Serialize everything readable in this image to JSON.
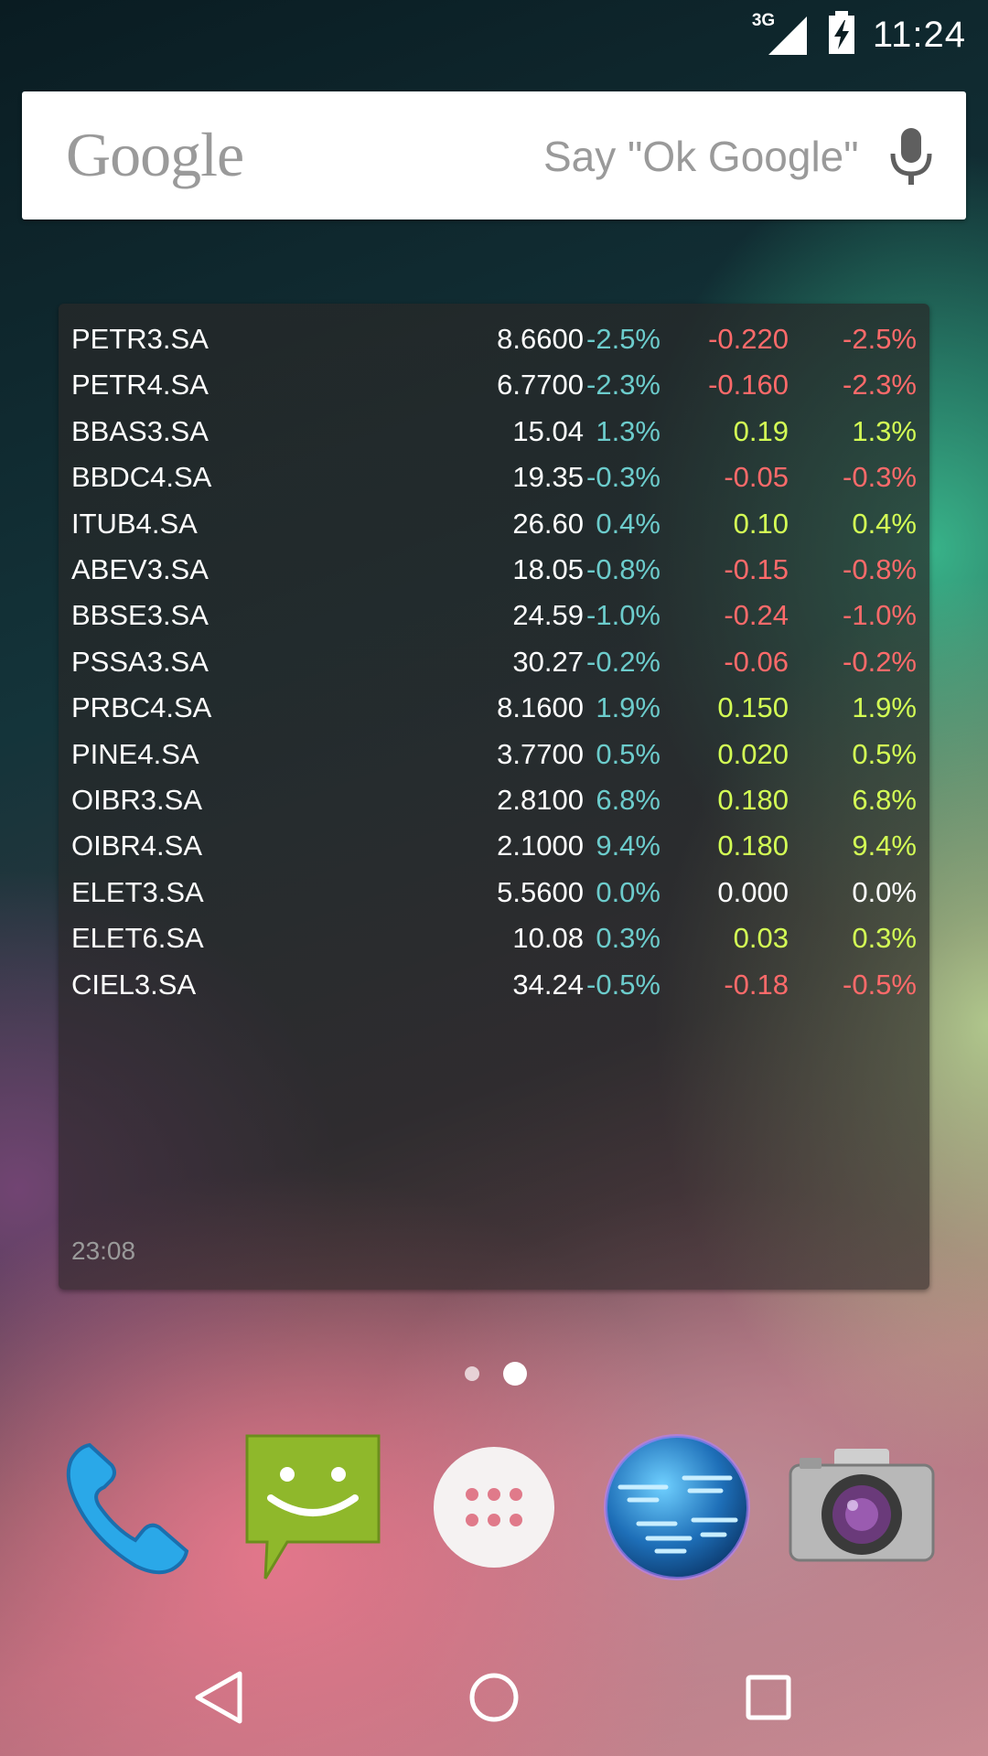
{
  "status_bar": {
    "network": "3G",
    "time": "11:24",
    "icons": [
      "signal-icon",
      "battery-charging-icon"
    ]
  },
  "search": {
    "logo_text": "Google",
    "hint": "Say \"Ok Google\"",
    "icons": [
      "mic-icon"
    ]
  },
  "widget": {
    "rows": [
      {
        "symbol": "PETR3.SA",
        "price": "8.6600",
        "pct": "-2.5%",
        "change": "-0.220",
        "pct2": "-2.5%",
        "trend": "neg"
      },
      {
        "symbol": "PETR4.SA",
        "price": "6.7700",
        "pct": "-2.3%",
        "change": "-0.160",
        "pct2": "-2.3%",
        "trend": "neg"
      },
      {
        "symbol": "BBAS3.SA",
        "price": "15.04",
        "pct": "1.3%",
        "change": "0.19",
        "pct2": "1.3%",
        "trend": "pos"
      },
      {
        "symbol": "BBDC4.SA",
        "price": "19.35",
        "pct": "-0.3%",
        "change": "-0.05",
        "pct2": "-0.3%",
        "trend": "neg"
      },
      {
        "symbol": "ITUB4.SA",
        "price": "26.60",
        "pct": "0.4%",
        "change": "0.10",
        "pct2": "0.4%",
        "trend": "pos"
      },
      {
        "symbol": "ABEV3.SA",
        "price": "18.05",
        "pct": "-0.8%",
        "change": "-0.15",
        "pct2": "-0.8%",
        "trend": "neg"
      },
      {
        "symbol": "BBSE3.SA",
        "price": "24.59",
        "pct": "-1.0%",
        "change": "-0.24",
        "pct2": "-1.0%",
        "trend": "neg"
      },
      {
        "symbol": "PSSA3.SA",
        "price": "30.27",
        "pct": "-0.2%",
        "change": "-0.06",
        "pct2": "-0.2%",
        "trend": "neg"
      },
      {
        "symbol": "PRBC4.SA",
        "price": "8.1600",
        "pct": "1.9%",
        "change": "0.150",
        "pct2": "1.9%",
        "trend": "pos"
      },
      {
        "symbol": "PINE4.SA",
        "price": "3.7700",
        "pct": "0.5%",
        "change": "0.020",
        "pct2": "0.5%",
        "trend": "pos"
      },
      {
        "symbol": "OIBR3.SA",
        "price": "2.8100",
        "pct": "6.8%",
        "change": "0.180",
        "pct2": "6.8%",
        "trend": "pos"
      },
      {
        "symbol": "OIBR4.SA",
        "price": "2.1000",
        "pct": "9.4%",
        "change": "0.180",
        "pct2": "9.4%",
        "trend": "pos"
      },
      {
        "symbol": "ELET3.SA",
        "price": "5.5600",
        "pct": "0.0%",
        "change": "0.000",
        "pct2": "0.0%",
        "trend": "zero"
      },
      {
        "symbol": "ELET6.SA",
        "price": "10.08",
        "pct": "0.3%",
        "change": "0.03",
        "pct2": "0.3%",
        "trend": "pos"
      },
      {
        "symbol": "CIEL3.SA",
        "price": "34.24",
        "pct": "-0.5%",
        "change": "-0.18",
        "pct2": "-0.5%",
        "trend": "neg"
      }
    ],
    "updated_time": "23:08"
  },
  "colors": {
    "negative": "#ff6a6a",
    "positive": "#d4ff55",
    "percent_cyan": "#6ccccc",
    "neutral": "#ffffff"
  },
  "page_indicator": {
    "pages": 2,
    "current": 2
  },
  "dock": {
    "apps": [
      "phone-icon",
      "messaging-icon",
      "app-drawer-icon",
      "browser-globe-icon",
      "camera-icon"
    ]
  },
  "nav_bar": {
    "buttons": [
      "back-icon",
      "home-icon",
      "recents-icon"
    ]
  }
}
